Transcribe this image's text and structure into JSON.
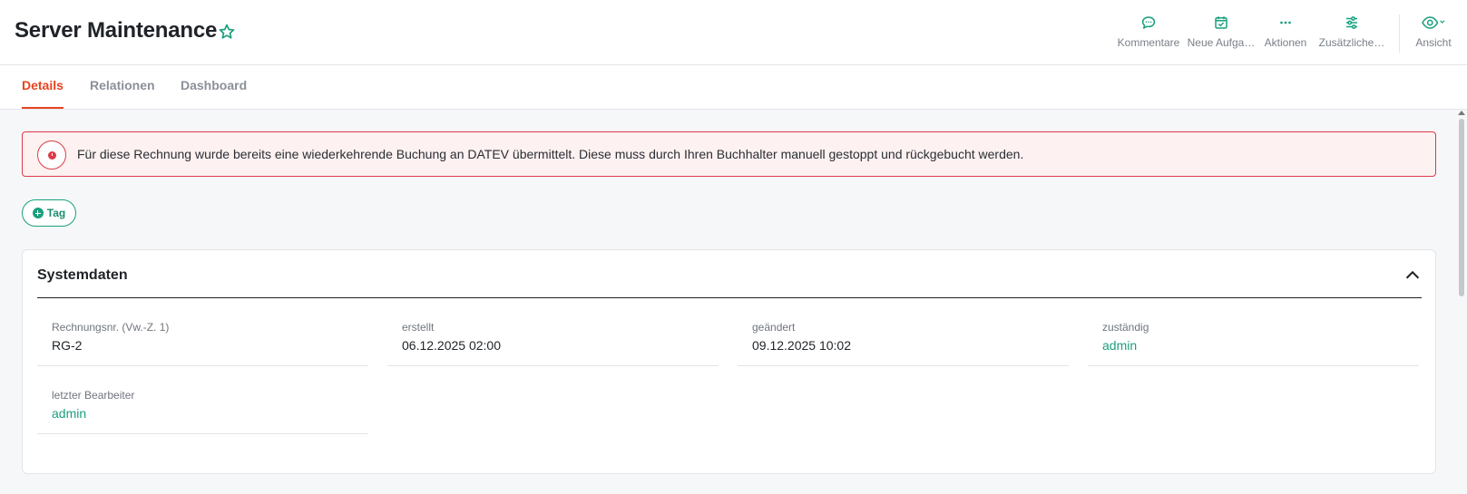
{
  "header": {
    "title": "Server Maintenance",
    "toolbar": {
      "comments": "Kommentare",
      "new_task": "Neue Aufga…",
      "actions": "Aktionen",
      "additional": "Zusätzliche…",
      "view": "Ansicht"
    }
  },
  "tabs": {
    "details": "Details",
    "relations": "Relationen",
    "dashboard": "Dashboard"
  },
  "alert": {
    "message": "Für diese Rechnung wurde bereits eine wiederkehrende Buchung an DATEV übermittelt. Diese muss durch Ihren Buchhalter manuell gestoppt und rückgebucht werden."
  },
  "tag_button": {
    "label": "Tag"
  },
  "systemdata": {
    "title": "Systemdaten",
    "fields": [
      {
        "label": "Rechnungsnr. (Vw.-Z. 1)",
        "value": "RG-2"
      },
      {
        "label": "erstellt",
        "value": "06.12.2025 02:00"
      },
      {
        "label": "geändert",
        "value": "09.12.2025 10:02"
      },
      {
        "label": "zuständig",
        "value": "admin"
      },
      {
        "label": "letzter Bearbeiter",
        "value": "admin"
      }
    ]
  },
  "colors": {
    "accent": "#1a9f7e",
    "active_tab": "#e8441e",
    "alert_border": "#dd3b47",
    "alert_bg": "#fdf1f1"
  }
}
